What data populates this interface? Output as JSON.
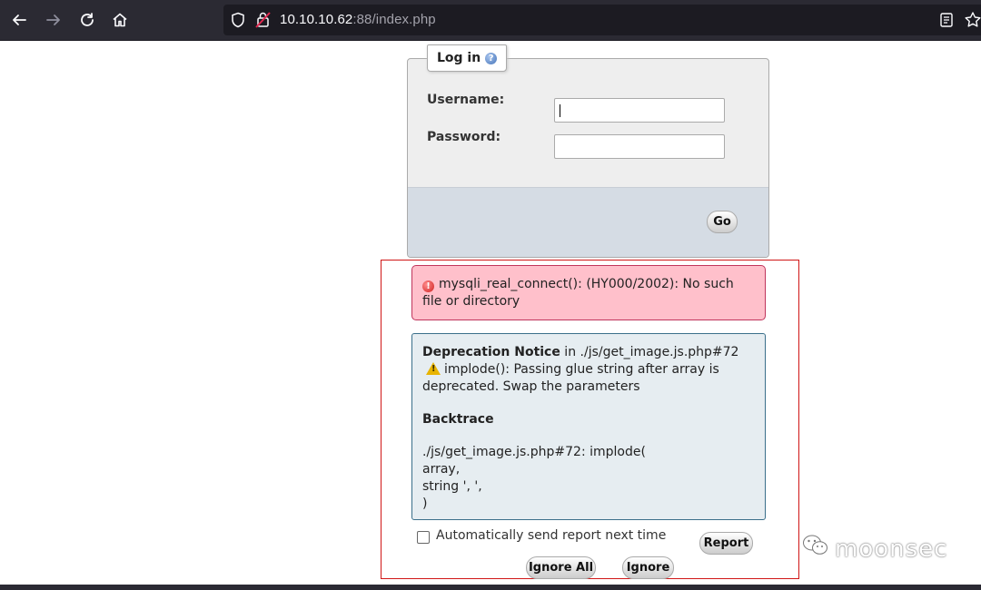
{
  "browser": {
    "url_host": "10.10.10.62",
    "url_rest": ":88/index.php"
  },
  "login": {
    "legend": "Log in",
    "username_label": "Username:",
    "password_label": "Password:",
    "username_value": "",
    "password_value": "",
    "go_label": "Go"
  },
  "error": {
    "message": "mysqli_real_connect(): (HY000/2002): No such file or directory"
  },
  "notice": {
    "title": "Deprecation Notice",
    "location": " in ./js/get_image.js.php#72",
    "message": "implode(): Passing glue string after array is deprecated. Swap the parameters",
    "backtrace_title": "Backtrace",
    "trace_line1": "./js/get_image.js.php#72: implode(",
    "trace_line2": "array,",
    "trace_line3": "string ', ',",
    "trace_line4": ")"
  },
  "report": {
    "auto_send_label": "Automatically send report next time",
    "auto_send_checked": false,
    "report_button": "Report",
    "ignore_all_button": "Ignore All",
    "ignore_button": "Ignore"
  },
  "watermark": {
    "text": "moonsec"
  }
}
